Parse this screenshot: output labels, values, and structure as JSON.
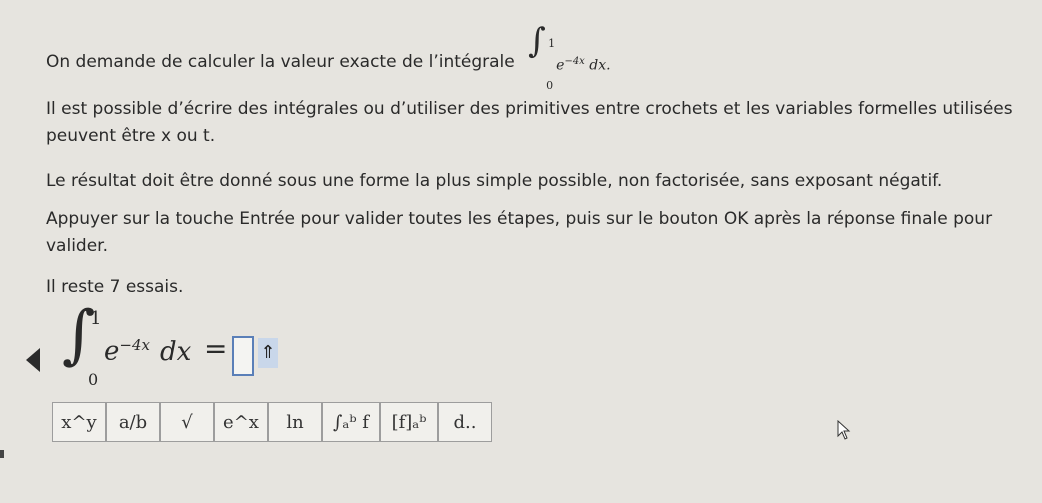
{
  "question": {
    "line1_prefix": "On demande de calculer la valeur exacte de l’intégrale",
    "line1_integral": {
      "upper": "1",
      "lower": "0",
      "integrand_base": "e",
      "integrand_exp": "−4x",
      "dx": "dx."
    },
    "para2": "Il est possible d’écrire des intégrales ou d’utiliser des primitives entre crochets et les variables formelles utilisées peuvent être x ou t.",
    "para3": "Le résultat doit être donné sous une forme la plus simple possible, non factorisée, sans exposant négatif.",
    "para4": "Appuyer sur la touche Entrée pour valider toutes les étapes, puis sur le bouton OK après la réponse finale pour valider.",
    "para5": "Il reste 7 essais."
  },
  "answer": {
    "upper": "1",
    "lower": "0",
    "base": "e",
    "exp": "−4x",
    "dx": "dx",
    "equals": "=",
    "arrow_label": "⇑"
  },
  "toolbar": {
    "buttons": [
      "x^y",
      "a/b",
      "√",
      "e^x",
      "ln",
      "∫ₐᵇ f",
      "[f]ₐᵇ",
      "d.."
    ]
  },
  "colors": {
    "background": "#e6e4df",
    "answer_border": "#5a7fb8",
    "arrow_bg": "#c9d7ea"
  }
}
